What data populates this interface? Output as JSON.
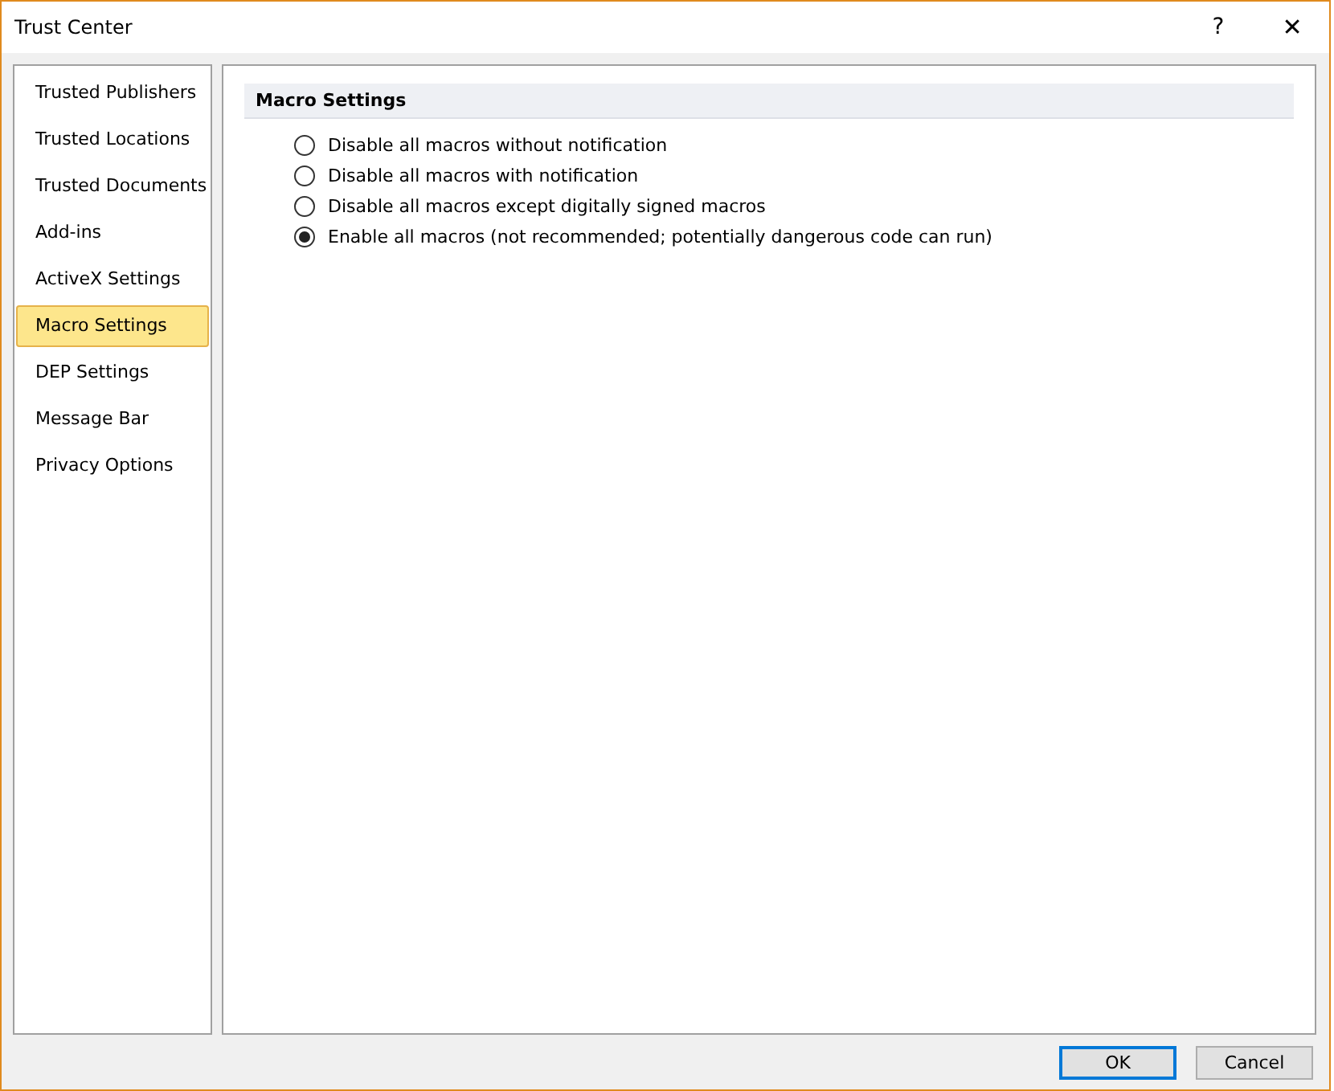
{
  "window": {
    "title": "Trust Center",
    "help": "?",
    "close": "✕"
  },
  "sidebar": {
    "items": [
      {
        "label": "Trusted Publishers",
        "selected": false
      },
      {
        "label": "Trusted Locations",
        "selected": false
      },
      {
        "label": "Trusted Documents",
        "selected": false
      },
      {
        "label": "Add-ins",
        "selected": false
      },
      {
        "label": "ActiveX Settings",
        "selected": false
      },
      {
        "label": "Macro Settings",
        "selected": true
      },
      {
        "label": "DEP Settings",
        "selected": false
      },
      {
        "label": "Message Bar",
        "selected": false
      },
      {
        "label": "Privacy Options",
        "selected": false
      }
    ]
  },
  "section": {
    "title": "Macro Settings",
    "options": [
      {
        "label": "Disable all macros without notification",
        "selected": false
      },
      {
        "label": "Disable all macros with notification",
        "selected": false
      },
      {
        "label": "Disable all macros except digitally signed macros",
        "selected": false
      },
      {
        "label": "Enable all macros (not recommended; potentially dangerous code can run)",
        "selected": true
      }
    ]
  },
  "buttons": [
    {
      "label": "OK",
      "default": true
    },
    {
      "label": "Cancel",
      "default": false
    }
  ]
}
